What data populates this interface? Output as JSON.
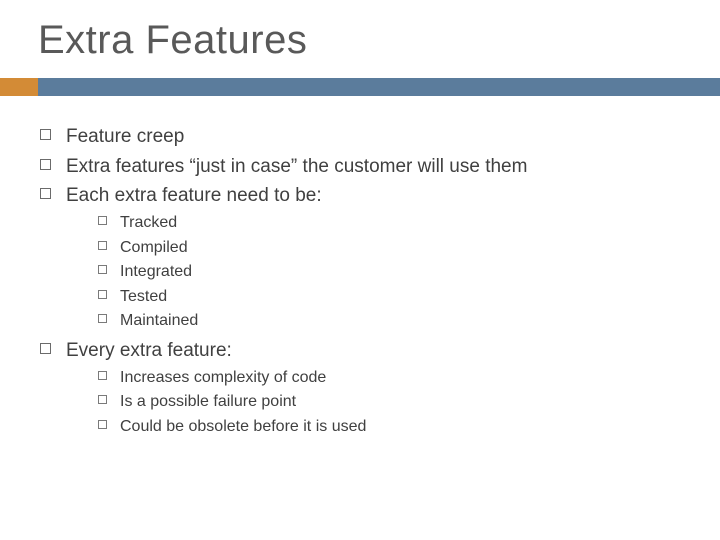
{
  "title": "Extra Features",
  "bullets": {
    "b0": "Feature creep",
    "b1": "Extra features “just in case” the customer will use them",
    "b2": "Each extra feature need to be:",
    "b2_sub": {
      "s0": "Tracked",
      "s1": "Compiled",
      "s2": "Integrated",
      "s3": "Tested",
      "s4": "Maintained"
    },
    "b3": "Every extra feature:",
    "b3_sub": {
      "s0": "Increases complexity of code",
      "s1": "Is a possible failure point",
      "s2": "Could be obsolete before it is used"
    }
  },
  "colors": {
    "accent_left": "#d38b36",
    "accent_right": "#5b7c9c"
  }
}
